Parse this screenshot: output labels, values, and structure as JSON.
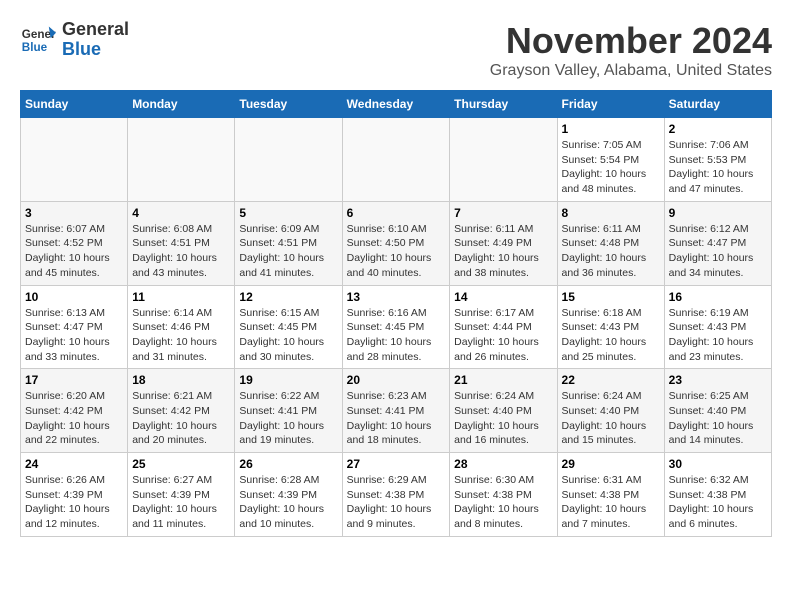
{
  "logo": {
    "line1": "General",
    "line2": "Blue"
  },
  "title": "November 2024",
  "location": "Grayson Valley, Alabama, United States",
  "days_of_week": [
    "Sunday",
    "Monday",
    "Tuesday",
    "Wednesday",
    "Thursday",
    "Friday",
    "Saturday"
  ],
  "weeks": [
    [
      {
        "day": "",
        "info": ""
      },
      {
        "day": "",
        "info": ""
      },
      {
        "day": "",
        "info": ""
      },
      {
        "day": "",
        "info": ""
      },
      {
        "day": "",
        "info": ""
      },
      {
        "day": "1",
        "info": "Sunrise: 7:05 AM\nSunset: 5:54 PM\nDaylight: 10 hours\nand 48 minutes."
      },
      {
        "day": "2",
        "info": "Sunrise: 7:06 AM\nSunset: 5:53 PM\nDaylight: 10 hours\nand 47 minutes."
      }
    ],
    [
      {
        "day": "3",
        "info": "Sunrise: 6:07 AM\nSunset: 4:52 PM\nDaylight: 10 hours\nand 45 minutes."
      },
      {
        "day": "4",
        "info": "Sunrise: 6:08 AM\nSunset: 4:51 PM\nDaylight: 10 hours\nand 43 minutes."
      },
      {
        "day": "5",
        "info": "Sunrise: 6:09 AM\nSunset: 4:51 PM\nDaylight: 10 hours\nand 41 minutes."
      },
      {
        "day": "6",
        "info": "Sunrise: 6:10 AM\nSunset: 4:50 PM\nDaylight: 10 hours\nand 40 minutes."
      },
      {
        "day": "7",
        "info": "Sunrise: 6:11 AM\nSunset: 4:49 PM\nDaylight: 10 hours\nand 38 minutes."
      },
      {
        "day": "8",
        "info": "Sunrise: 6:11 AM\nSunset: 4:48 PM\nDaylight: 10 hours\nand 36 minutes."
      },
      {
        "day": "9",
        "info": "Sunrise: 6:12 AM\nSunset: 4:47 PM\nDaylight: 10 hours\nand 34 minutes."
      }
    ],
    [
      {
        "day": "10",
        "info": "Sunrise: 6:13 AM\nSunset: 4:47 PM\nDaylight: 10 hours\nand 33 minutes."
      },
      {
        "day": "11",
        "info": "Sunrise: 6:14 AM\nSunset: 4:46 PM\nDaylight: 10 hours\nand 31 minutes."
      },
      {
        "day": "12",
        "info": "Sunrise: 6:15 AM\nSunset: 4:45 PM\nDaylight: 10 hours\nand 30 minutes."
      },
      {
        "day": "13",
        "info": "Sunrise: 6:16 AM\nSunset: 4:45 PM\nDaylight: 10 hours\nand 28 minutes."
      },
      {
        "day": "14",
        "info": "Sunrise: 6:17 AM\nSunset: 4:44 PM\nDaylight: 10 hours\nand 26 minutes."
      },
      {
        "day": "15",
        "info": "Sunrise: 6:18 AM\nSunset: 4:43 PM\nDaylight: 10 hours\nand 25 minutes."
      },
      {
        "day": "16",
        "info": "Sunrise: 6:19 AM\nSunset: 4:43 PM\nDaylight: 10 hours\nand 23 minutes."
      }
    ],
    [
      {
        "day": "17",
        "info": "Sunrise: 6:20 AM\nSunset: 4:42 PM\nDaylight: 10 hours\nand 22 minutes."
      },
      {
        "day": "18",
        "info": "Sunrise: 6:21 AM\nSunset: 4:42 PM\nDaylight: 10 hours\nand 20 minutes."
      },
      {
        "day": "19",
        "info": "Sunrise: 6:22 AM\nSunset: 4:41 PM\nDaylight: 10 hours\nand 19 minutes."
      },
      {
        "day": "20",
        "info": "Sunrise: 6:23 AM\nSunset: 4:41 PM\nDaylight: 10 hours\nand 18 minutes."
      },
      {
        "day": "21",
        "info": "Sunrise: 6:24 AM\nSunset: 4:40 PM\nDaylight: 10 hours\nand 16 minutes."
      },
      {
        "day": "22",
        "info": "Sunrise: 6:24 AM\nSunset: 4:40 PM\nDaylight: 10 hours\nand 15 minutes."
      },
      {
        "day": "23",
        "info": "Sunrise: 6:25 AM\nSunset: 4:40 PM\nDaylight: 10 hours\nand 14 minutes."
      }
    ],
    [
      {
        "day": "24",
        "info": "Sunrise: 6:26 AM\nSunset: 4:39 PM\nDaylight: 10 hours\nand 12 minutes."
      },
      {
        "day": "25",
        "info": "Sunrise: 6:27 AM\nSunset: 4:39 PM\nDaylight: 10 hours\nand 11 minutes."
      },
      {
        "day": "26",
        "info": "Sunrise: 6:28 AM\nSunset: 4:39 PM\nDaylight: 10 hours\nand 10 minutes."
      },
      {
        "day": "27",
        "info": "Sunrise: 6:29 AM\nSunset: 4:38 PM\nDaylight: 10 hours\nand 9 minutes."
      },
      {
        "day": "28",
        "info": "Sunrise: 6:30 AM\nSunset: 4:38 PM\nDaylight: 10 hours\nand 8 minutes."
      },
      {
        "day": "29",
        "info": "Sunrise: 6:31 AM\nSunset: 4:38 PM\nDaylight: 10 hours\nand 7 minutes."
      },
      {
        "day": "30",
        "info": "Sunrise: 6:32 AM\nSunset: 4:38 PM\nDaylight: 10 hours\nand 6 minutes."
      }
    ]
  ]
}
